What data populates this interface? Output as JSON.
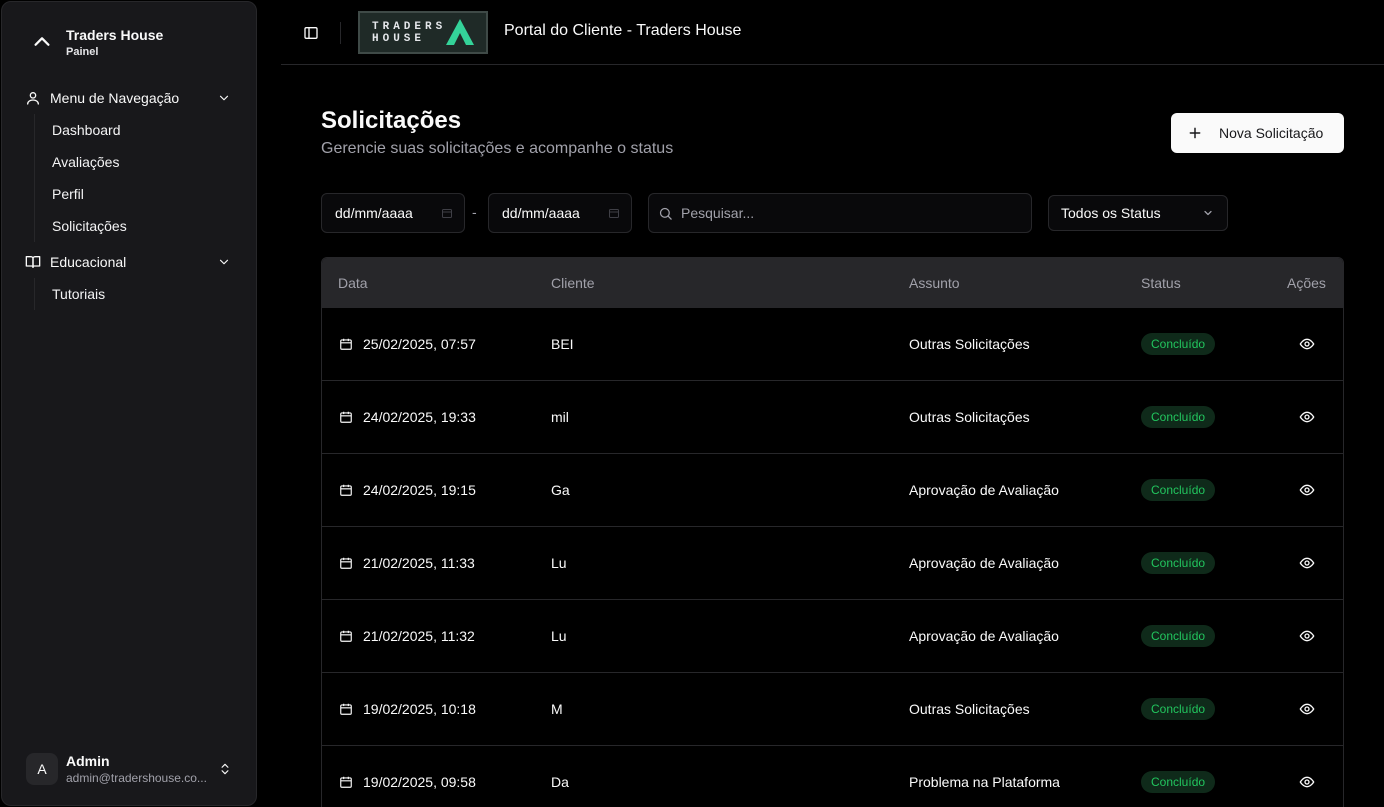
{
  "sidebar": {
    "brand": {
      "title": "Traders House",
      "subtitle": "Painel",
      "icon": "chevron-up-icon"
    },
    "groups": [
      {
        "label": "Menu de Navegação",
        "icon": "user-icon",
        "items": [
          "Dashboard",
          "Avaliações",
          "Perfil",
          "Solicitações"
        ]
      },
      {
        "label": "Educacional",
        "icon": "book-open-icon",
        "items": [
          "Tutoriais"
        ]
      }
    ],
    "user": {
      "initial": "A",
      "name": "Admin",
      "email": "admin@tradershouse.co..."
    }
  },
  "header": {
    "logo_line1": "TRADERS",
    "logo_line2": "HOUSE",
    "title": "Portal do Cliente - Traders House"
  },
  "page": {
    "title": "Solicitações",
    "subtitle": "Gerencie suas solicitações e acompanhe o status",
    "new_button": "Nova Solicitação"
  },
  "filters": {
    "date_from": "dd/mm/aaaa",
    "date_separator": "-",
    "date_to": "dd/mm/aaaa",
    "search_placeholder": "Pesquisar...",
    "status_select": "Todos os Status"
  },
  "table": {
    "headers": {
      "date": "Data",
      "client": "Cliente",
      "subject": "Assunto",
      "status": "Status",
      "actions": "Ações"
    },
    "rows": [
      {
        "date": "25/02/2025, 07:57",
        "client": "BEI",
        "subject": "Outras Solicitações",
        "status": "Concluído"
      },
      {
        "date": "24/02/2025, 19:33",
        "client": "mil",
        "subject": "Outras Solicitações",
        "status": "Concluído"
      },
      {
        "date": "24/02/2025, 19:15",
        "client": "Ga",
        "subject": "Aprovação de Avaliação",
        "status": "Concluído"
      },
      {
        "date": "21/02/2025, 11:33",
        "client": "Lu",
        "subject": "Aprovação de Avaliação",
        "status": "Concluído"
      },
      {
        "date": "21/02/2025, 11:32",
        "client": "Lu",
        "subject": "Aprovação de Avaliação",
        "status": "Concluído"
      },
      {
        "date": "19/02/2025, 10:18",
        "client": "M",
        "subject": "Outras Solicitações",
        "status": "Concluído"
      },
      {
        "date": "19/02/2025, 09:58",
        "client": "Da",
        "subject": "Problema na Plataforma",
        "status": "Concluído"
      }
    ]
  },
  "colors": {
    "background": "#000000",
    "sidebar": "#18181b",
    "status_text": "#22c55e",
    "status_bg": "#0f2a1a",
    "logo_accent": "#34d399"
  }
}
